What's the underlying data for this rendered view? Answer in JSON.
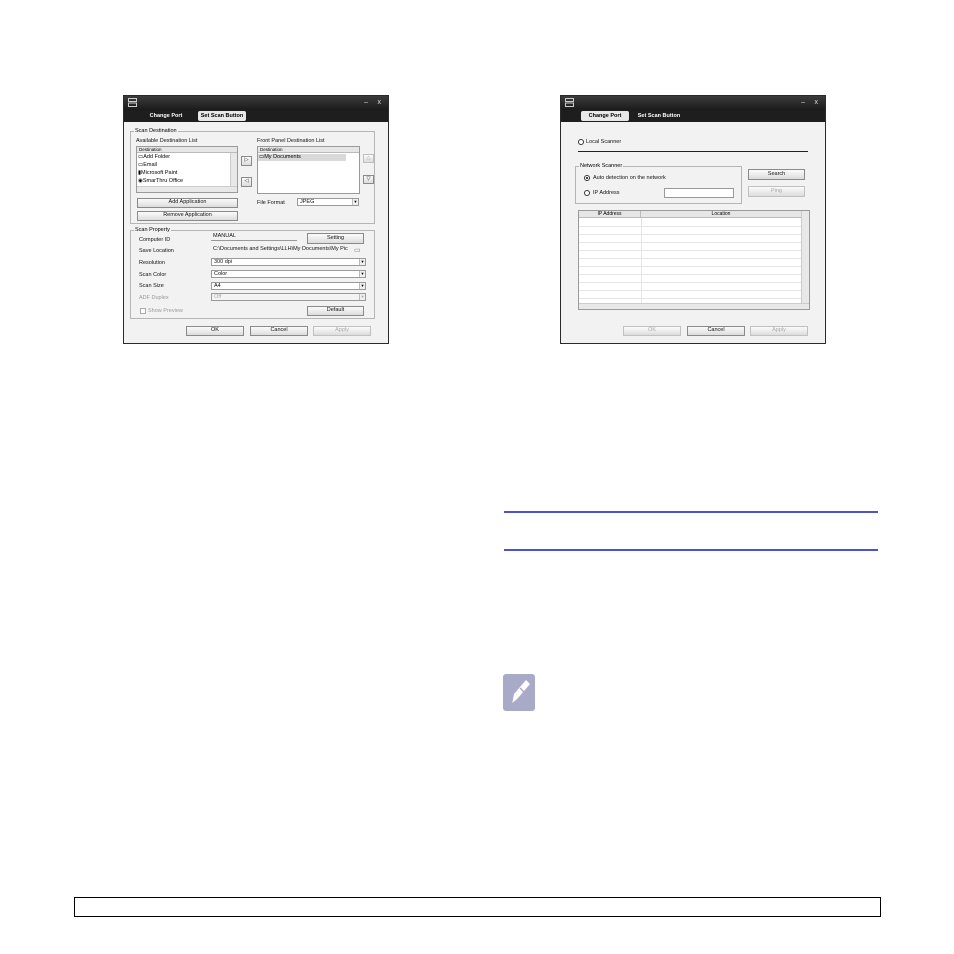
{
  "left_dialog": {
    "tabs": {
      "change_port": "Change Port",
      "set_scan_button": "Set Scan Button"
    },
    "title_controls": {
      "minimize": "–",
      "close": "x"
    },
    "scan_destination": {
      "group_title": "Scan Destination",
      "available_title": "Available Destination List",
      "available_header": "Destination",
      "available_items": [
        "Add Folder",
        "Email",
        "Microsoft Paint",
        "SmarThru Office"
      ],
      "front_title": "Front Panel Destination List",
      "front_header": "Destination",
      "front_items": [
        "My Documents"
      ],
      "add_application": "Add Application",
      "remove_application": "Remove Application",
      "file_format_label": "File Format",
      "file_format_value": "JPEG"
    },
    "scan_property": {
      "group_title": "Scan Property",
      "computer_id_label": "Computer ID",
      "computer_id_value": "MANUAL",
      "setting_button": "Setting",
      "save_location_label": "Save Location",
      "save_location_value": "C:\\Documents and Settings\\LLH\\My Documents\\My Pic",
      "resolution_label": "Resolution",
      "resolution_value": "300 dpi",
      "scan_color_label": "Scan Color",
      "scan_color_value": "Color",
      "scan_size_label": "Scan Size",
      "scan_size_value": "A4",
      "adf_duplex_label": "ADF Duplex",
      "adf_duplex_value": "Off",
      "show_preview_label": "Show Preview",
      "default_button": "Default"
    },
    "footer": {
      "ok": "OK",
      "cancel": "Cancel",
      "apply": "Apply"
    }
  },
  "right_dialog": {
    "tabs": {
      "change_port": "Change Port",
      "set_scan_button": "Set Scan Button"
    },
    "title_controls": {
      "minimize": "–",
      "close": "x"
    },
    "local_scanner_label": "Local Scanner",
    "network_scanner": {
      "group_title": "Network Scanner",
      "auto_detection_label": "Auto detection on the network",
      "ip_address_label": "IP Address",
      "search_button": "Search",
      "ping_button": "Ping"
    },
    "table": {
      "columns": [
        "IP Address",
        "Location"
      ],
      "rows": []
    },
    "footer": {
      "ok": "OK",
      "cancel": "Cancel",
      "apply": "Apply"
    }
  }
}
